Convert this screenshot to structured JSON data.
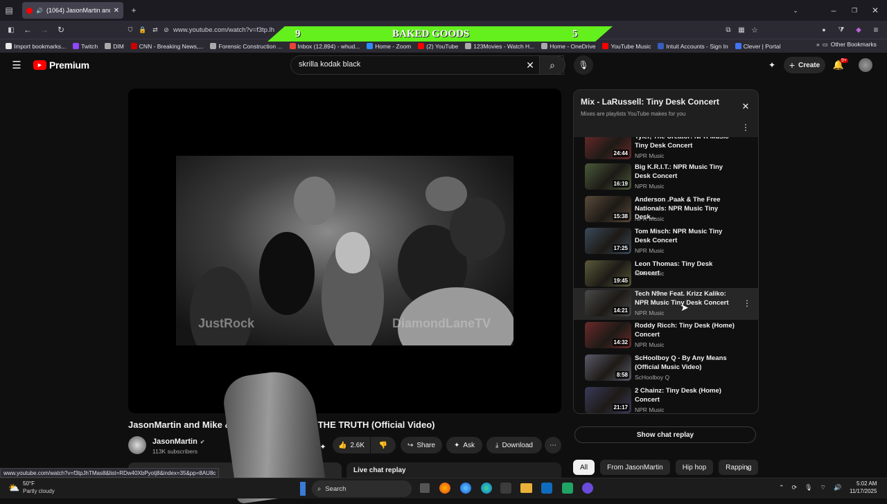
{
  "browser": {
    "tab_title": "(1064) JasonMartin and Mik",
    "url": "www.youtube.com/watch?v=f3tp.lh",
    "status_url": "www.youtube.com/watch?v=f3tpJhTMas8&list=RDw40XbPyotj8&index=35&pp=8AU8c"
  },
  "bookmarks": [
    {
      "label": "Import bookmarks...",
      "color": "#e8e8e8"
    },
    {
      "label": "Twitch",
      "color": "#9146ff"
    },
    {
      "label": "DIM",
      "color": "#aaaaaa"
    },
    {
      "label": "CNN - Breaking News,...",
      "color": "#cc0000"
    },
    {
      "label": "Forensic Construction ...",
      "color": "#aaaaaa"
    },
    {
      "label": "Inbox (12,894) - whud...",
      "color": "#ea4335"
    },
    {
      "label": "Home - Zoom",
      "color": "#2d8cff"
    },
    {
      "label": "(2) YouTube",
      "color": "#ff0000"
    },
    {
      "label": "123Movies - Watch H...",
      "color": "#aaaaaa"
    },
    {
      "label": "Home - OneDrive",
      "color": "#aaaaaa"
    },
    {
      "label": "YouTube Music",
      "color": "#ff0000"
    },
    {
      "label": "Intuit Accounts - Sign In",
      "color": "#365ebf"
    },
    {
      "label": "Clever | Portal",
      "color": "#4274f6"
    }
  ],
  "other_bookmarks": "Other Bookmarks",
  "banner": {
    "left": "9",
    "center": "BAKED GOODS",
    "right": "5"
  },
  "youtube": {
    "logo": "Premium",
    "search_value": "skrilla kodak black",
    "create_label": "Create",
    "notif_badge": "9+"
  },
  "video": {
    "title": "JasonMartin and Mike & Keys - V",
    "title_tail": "THE TRUTH (Official Video)",
    "watermark_left": "JustRock",
    "watermark_right": "DiamondLaneTV",
    "channel": "JasonMartin",
    "subscribers": "113K subscribers",
    "likes": "2.6K",
    "share": "Share",
    "ask": "Ask",
    "download": "Download",
    "live_chat": "Live chat replay"
  },
  "playlist": {
    "title": "Mix - LaRussell: Tiny Desk Concert",
    "subtitle": "Mixes are playlists YouTube makes for you",
    "items": [
      {
        "title": "Tyler, The Creator: NPR Music Tiny Desk Concert",
        "channel": "NPR Music",
        "duration": "24:44"
      },
      {
        "title": "Big K.R.I.T.: NPR Music Tiny Desk Concert",
        "channel": "NPR Music",
        "duration": "16:19"
      },
      {
        "title": "Anderson .Paak & The Free Nationals: NPR Music Tiny Desk...",
        "channel": "NPR Music",
        "duration": "15:38"
      },
      {
        "title": "Tom Misch: NPR Music Tiny Desk Concert",
        "channel": "NPR Music",
        "duration": "17:25"
      },
      {
        "title": "Leon Thomas: Tiny Desk Concert",
        "channel": "NPR Music",
        "duration": "19:45"
      },
      {
        "title": "Tech N9ne Feat. Krizz Kaliko: NPR Music Tiny Desk Concert",
        "channel": "NPR Music",
        "duration": "14:21"
      },
      {
        "title": "Roddy Ricch: Tiny Desk (Home) Concert",
        "channel": "NPR Music",
        "duration": "14:32"
      },
      {
        "title": "ScHoolboy Q - By Any Means (Official Music Video)",
        "channel": "ScHoolboy Q",
        "duration": "8:58"
      },
      {
        "title": "2 Chainz: Tiny Desk (Home) Concert",
        "channel": "NPR Music",
        "duration": "21:17"
      }
    ],
    "show_chat": "Show chat replay"
  },
  "chips": [
    "All",
    "From JasonMartin",
    "Hip hop",
    "Rapping"
  ],
  "taskbar": {
    "weather_temp": "50°F",
    "weather_desc": "Partly cloudy",
    "search": "Search",
    "time": "5:02 AM",
    "date": "11/17/2025"
  }
}
